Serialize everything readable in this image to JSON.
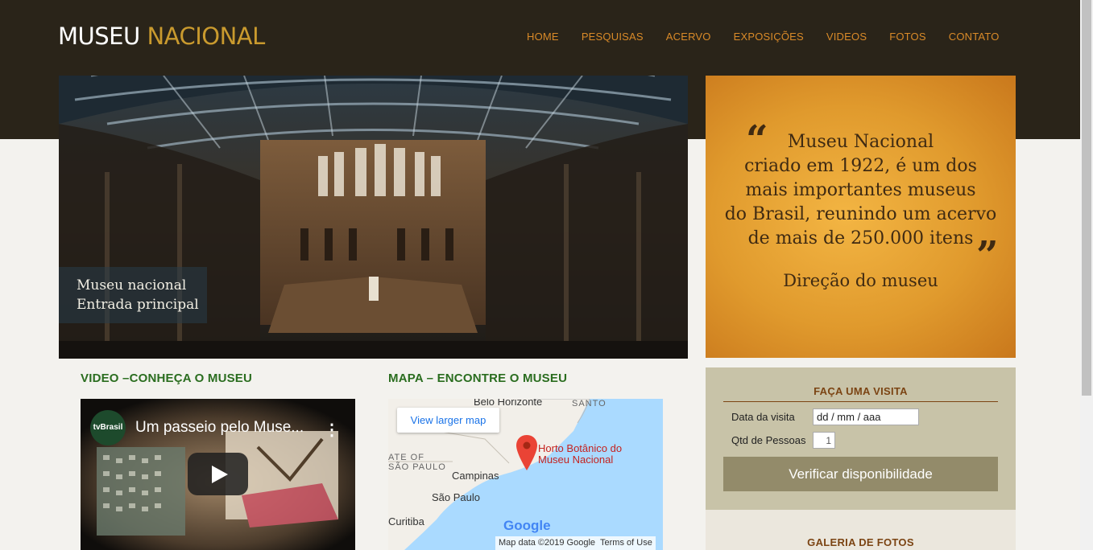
{
  "header": {
    "logo_part1": "MUSEU",
    "logo_part2": "NACIONAL",
    "nav": [
      "HOME",
      "PESQUISAS",
      "ACERVO",
      "EXPOSIÇÕES",
      "VIDEOS",
      "FOTOS",
      "CONTATO"
    ]
  },
  "hero": {
    "caption_line1": "Museu nacional",
    "caption_line2": "Entrada principal"
  },
  "quote": {
    "open_mark": "“",
    "close_mark": "”",
    "lines": [
      "Museu Nacional",
      "criado em 1922, é um dos",
      "mais importantes museus",
      "do Brasil, reunindo um acervo",
      "de mais de 250.000 itens"
    ],
    "signature": "Direção do museu"
  },
  "booking": {
    "title": "FAÇA UMA VISITA",
    "date_label": "Data da visita",
    "date_placeholder": "dd / mm / aaa",
    "qty_label": "Qtd de Pessoas",
    "qty_value": "1",
    "button": "Verificar disponibilidade"
  },
  "gallery": {
    "title": "GALERIA DE FOTOS"
  },
  "video_section": {
    "title": "VIDEO –CONHEÇA O MUSEU",
    "channel": "tvBrasil",
    "video_title": "Um passeio pelo Muse...",
    "menu": "⋮"
  },
  "map_section": {
    "title": "MAPA – ENCONTRE O MUSEU",
    "larger_map": "View larger map",
    "labels": {
      "belo_horizonte": "Belo Horizonte",
      "santo": "SANTO",
      "sao_paulo_state_1": "ATE OF",
      "sao_paulo_state_2": "SÃO PAULO",
      "campinas": "Campinas",
      "sao_paulo": "São Paulo",
      "curitiba": "Curitiba"
    },
    "poi_line1": "Horto Botânico do",
    "poi_line2": "Museu Nacional",
    "google": "Google",
    "footer_data": "Map data ©2019 Google",
    "footer_terms": "Terms of Use"
  },
  "colors": {
    "header_bg": "#2a2419",
    "nav_link": "#d98a28",
    "logo_accent": "#c99a2e",
    "section_title": "#2a6d1f",
    "booking_title": "#7b4413",
    "booking_button": "#938b6a"
  }
}
